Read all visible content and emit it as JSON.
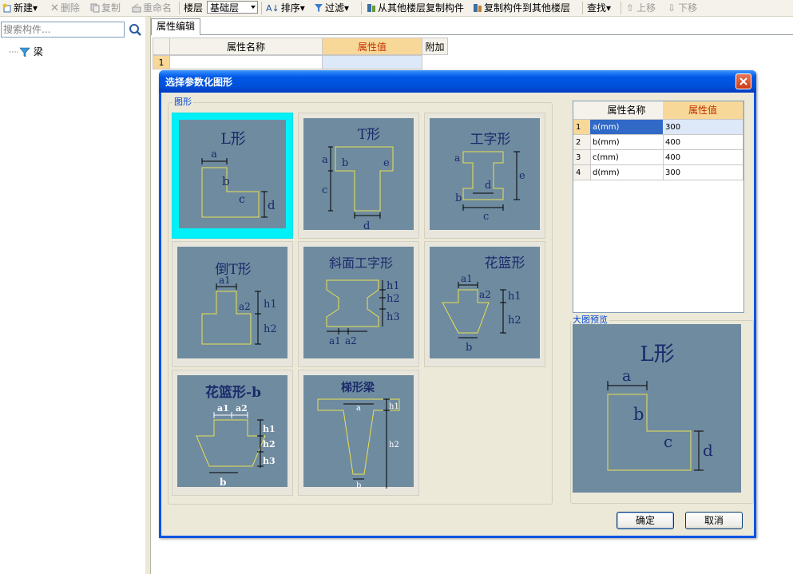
{
  "toolbar": {
    "new": "新建",
    "delete": "删除",
    "copy": "复制",
    "rename": "重命名",
    "layer_label": "楼层",
    "layer_value": "基础层",
    "sort": "排序",
    "filter": "过滤",
    "copy_from_other": "从其他楼层复制构件",
    "copy_to_other": "复制构件到其他楼层",
    "find": "查找",
    "move_up": "上移",
    "move_down": "下移"
  },
  "left": {
    "search_placeholder": "搜索构件...",
    "tree_item": "梁"
  },
  "tab": {
    "label": "属性编辑"
  },
  "bg_grid": {
    "col_name": "属性名称",
    "col_value": "属性值",
    "col_extra": "附加",
    "row1": "1"
  },
  "dialog": {
    "title": "选择参数化图形",
    "group_label": "图形",
    "shapes": [
      {
        "title": "L形"
      },
      {
        "title": "T形"
      },
      {
        "title": "工字形"
      },
      {
        "title": "倒T形"
      },
      {
        "title": "斜面工字形"
      },
      {
        "title": "花篮形"
      },
      {
        "title": "花篮形-b"
      },
      {
        "title": "梯形梁"
      }
    ],
    "table": {
      "col_name": "属性名称",
      "col_value": "属性值",
      "rows": [
        {
          "n": "1",
          "name": "a(mm)",
          "value": "300"
        },
        {
          "n": "2",
          "name": "b(mm)",
          "value": "400"
        },
        {
          "n": "3",
          "name": "c(mm)",
          "value": "400"
        },
        {
          "n": "4",
          "name": "d(mm)",
          "value": "300"
        }
      ]
    },
    "preview_label": "大图预览",
    "preview_title": "L形",
    "ok": "确定",
    "cancel": "取消"
  },
  "colors": {
    "shape_bg": "#6f8ba0",
    "shape_line": "#e8e050",
    "selected": "#00f0f8",
    "title_bar": "#0054e3"
  }
}
